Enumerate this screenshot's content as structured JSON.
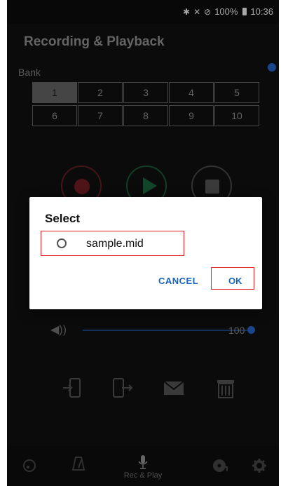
{
  "status": {
    "time": "10:36",
    "battery": "100%"
  },
  "app": {
    "title": "Recording & Playback"
  },
  "bank": {
    "label": "Bank",
    "cells": [
      "1",
      "2",
      "3",
      "4",
      "5",
      "6",
      "7",
      "8",
      "9",
      "10"
    ],
    "active": "1"
  },
  "volume": {
    "value": "100",
    "level_percent": 100
  },
  "dialog": {
    "title": "Select",
    "option": "sample.mid",
    "cancel": "CANCEL",
    "ok": "OK"
  },
  "bottomnav": {
    "recplay_label": "Rec & Play"
  },
  "colors": {
    "accent_blue": "#2a6bd6",
    "dialog_button": "#1565c0",
    "highlight_red": "#e02020"
  }
}
